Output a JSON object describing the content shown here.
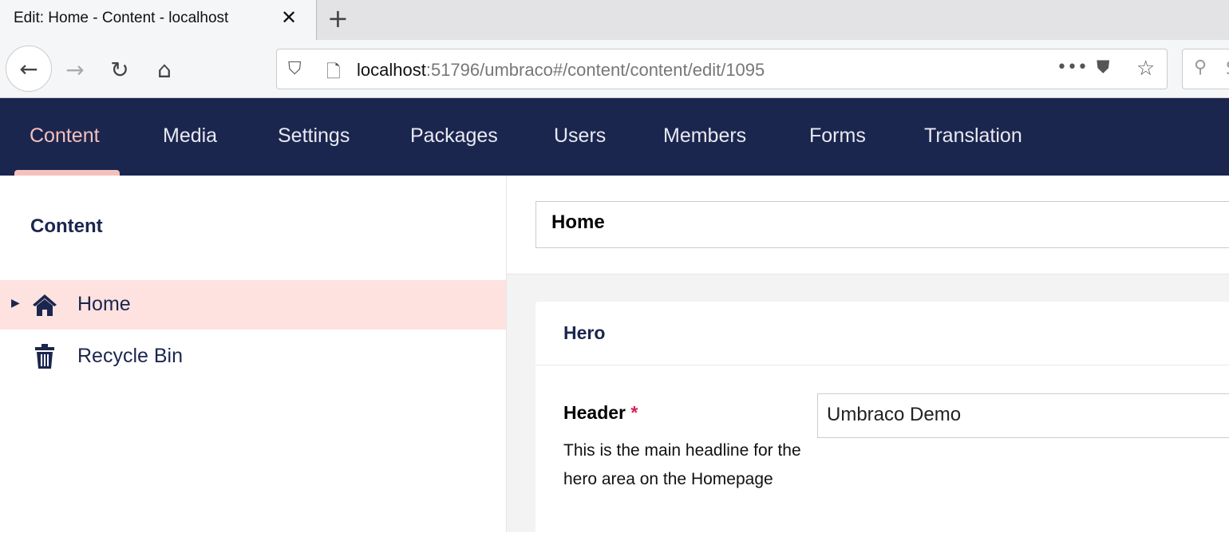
{
  "browser": {
    "tab_title": "Edit: Home - Content - localhost",
    "tab_close": "✕",
    "new_tab": "+",
    "url_host": "localhost",
    "url_rest": ":51796/umbraco#/content/content/edit/1095",
    "search_placeholder": "S"
  },
  "sections": [
    {
      "label": "Content",
      "active": true
    },
    {
      "label": "Media"
    },
    {
      "label": "Settings"
    },
    {
      "label": "Packages"
    },
    {
      "label": "Users"
    },
    {
      "label": "Members"
    },
    {
      "label": "Forms"
    },
    {
      "label": "Translation"
    }
  ],
  "tree": {
    "title": "Content",
    "nodes": [
      {
        "label": "Home",
        "icon": "home-icon",
        "selected": true
      },
      {
        "label": "Recycle Bin",
        "icon": "trash-icon"
      }
    ]
  },
  "editor": {
    "name_value": "Home",
    "group_title": "Hero",
    "property": {
      "label": "Header",
      "required_mark": "*",
      "description": "This is the main headline for the hero area on the Homepage",
      "value": "Umbraco Demo"
    }
  },
  "colors": {
    "header_bg": "#1b264f",
    "active_accent": "#f5c1bc",
    "selected_node_bg": "#fde2df"
  }
}
